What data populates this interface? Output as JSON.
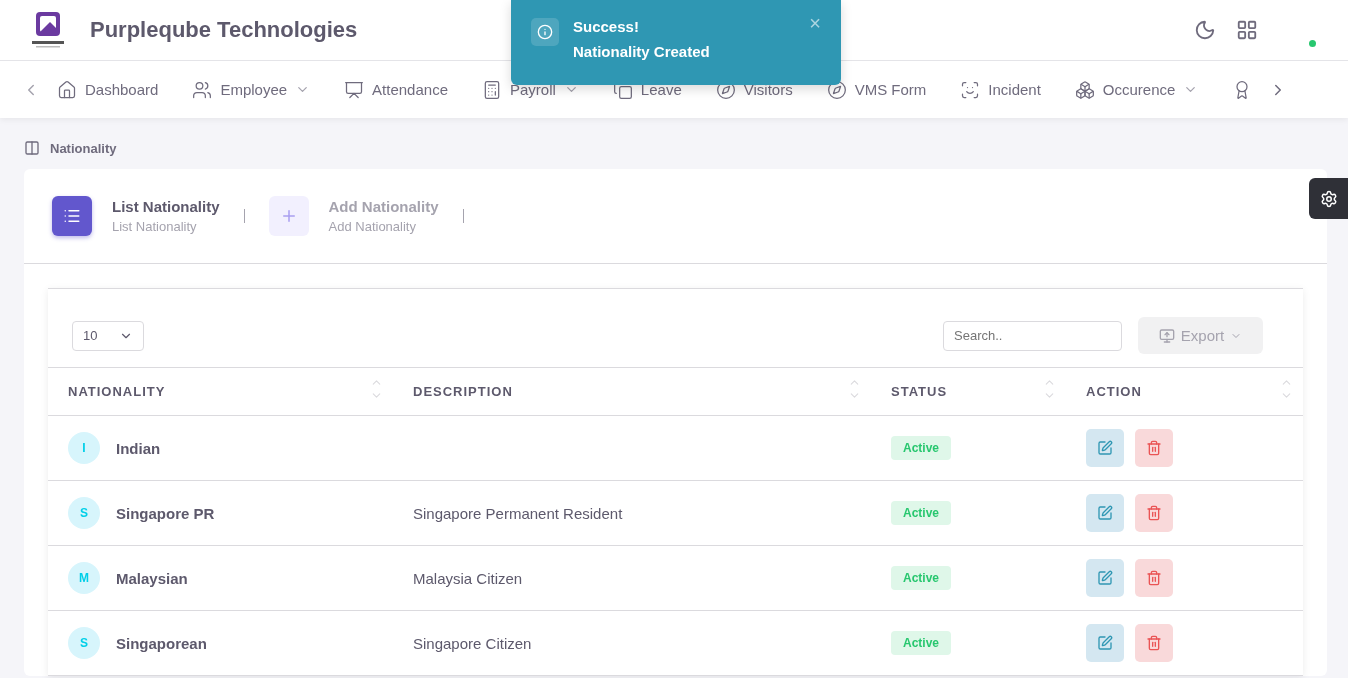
{
  "header": {
    "company": "Purpleqube Technologies"
  },
  "nav": [
    {
      "label": "Dashboard",
      "dropdown": false
    },
    {
      "label": "Employee",
      "dropdown": true
    },
    {
      "label": "Attendance",
      "dropdown": false
    },
    {
      "label": "Payroll",
      "dropdown": true
    },
    {
      "label": "Leave",
      "dropdown": false
    },
    {
      "label": "Visitors",
      "dropdown": false
    },
    {
      "label": "VMS Form",
      "dropdown": false
    },
    {
      "label": "Incident",
      "dropdown": false
    },
    {
      "label": "Occurence",
      "dropdown": true
    },
    {
      "dropdown": false
    }
  ],
  "toast": {
    "title": "Success!",
    "message": "Nationality Created",
    "close": "×"
  },
  "breadcrumb": "Nationality",
  "tabs": [
    {
      "title": "List Nationality",
      "subtitle": "List Nationality",
      "selected": true
    },
    {
      "title": "Add Nationality",
      "subtitle": "Add Nationality",
      "selected": false
    }
  ],
  "table": {
    "page_size": "10",
    "search_placeholder": "Search..",
    "export": "Export",
    "columns": [
      "NATIONALITY",
      "DESCRIPTION",
      "STATUS",
      "ACTION"
    ],
    "rows": [
      {
        "initial": "I",
        "name": "Indian",
        "status": "Active"
      },
      {
        "initial": "S",
        "name": "Singapore PR",
        "description": "Singapore Permanent Resident",
        "status": "Active"
      },
      {
        "initial": "M",
        "name": "Malaysian",
        "description": "Malaysia Citizen",
        "status": "Active"
      },
      {
        "initial": "S",
        "name": "Singaporean",
        "description": "Singapore Citizen",
        "status": "Active"
      }
    ]
  }
}
